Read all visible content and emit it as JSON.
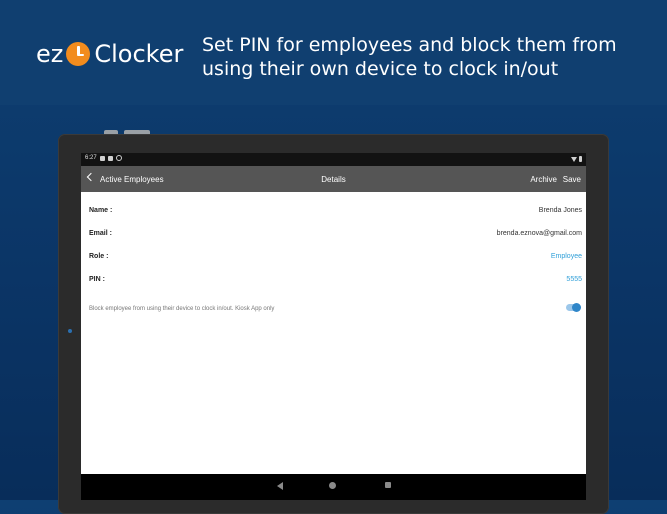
{
  "banner": {
    "logo_prefix": "ez",
    "logo_suffix": "Clocker",
    "headline_line1": "Set PIN for employees and block them from",
    "headline_line2": "using their own device to clock in/out"
  },
  "status_bar": {
    "time": "6:27"
  },
  "app_bar": {
    "back_label": "Active Employees",
    "title": "Details",
    "archive_label": "Archive",
    "save_label": "Save"
  },
  "details": {
    "name_label": "Name :",
    "name_value": "Brenda Jones",
    "email_label": "Email :",
    "email_value": "brenda.eznova@gmail.com",
    "role_label": "Role :",
    "role_value": "Employee",
    "pin_label": "PIN :",
    "pin_value": "5555",
    "kiosk_text": "Block employee from using their device to clock in/out. Kiosk App only",
    "kiosk_enabled": true
  },
  "colors": {
    "accent": "#2f9fd8",
    "logo_orange": "#f28c1e",
    "app_bar": "#555555"
  }
}
